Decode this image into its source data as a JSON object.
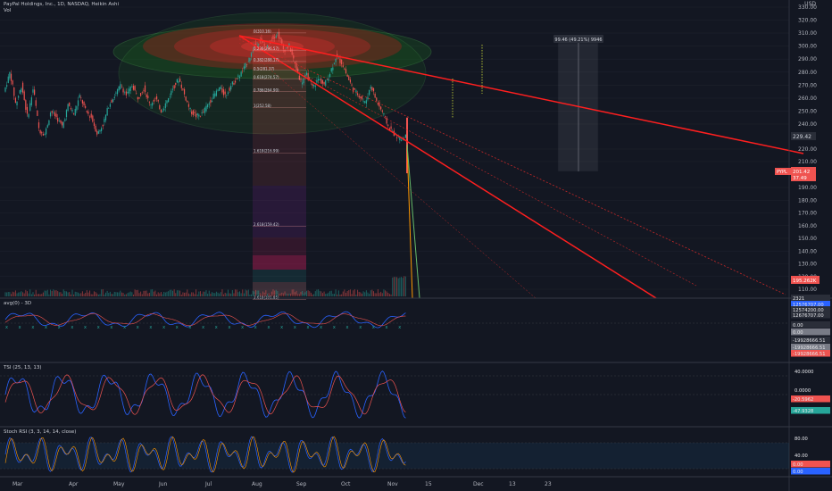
{
  "header": {
    "title": "PayPal Holdings, Inc., 1D, NASDAQ, Heikin Ashi",
    "vol_label": "Vol",
    "currency": "USD"
  },
  "panes": {
    "macd_title": "avg(0) - 3D",
    "tsi_title": "TSI (25, 13, 13)",
    "stoch_title": "Stoch RSI (3, 3, 14, 14, close)"
  },
  "colors": {
    "up": "#26a69a",
    "down": "#ef5350",
    "trendline": "#ff1f1f",
    "highlight_box": "#ef5350",
    "background": "#131722"
  },
  "price_labels": {
    "last": "229.42",
    "ticker": "PYPL",
    "ticker_price": "201.42",
    "ticker_sub": "37.49",
    "volume": "195.262K"
  },
  "measure_label": "99.46 (49.21%) 9946",
  "fib_levels": [
    {
      "label": "0(310.16)",
      "value": 310.16
    },
    {
      "label": "0.236(296.57)",
      "value": 296.57
    },
    {
      "label": "0.382(288.17)",
      "value": 288.17
    },
    {
      "label": "0.5(281.37)",
      "value": 281.37
    },
    {
      "label": "0.618(274.57)",
      "value": 274.57
    },
    {
      "label": "0.786(264.90)",
      "value": 264.9
    },
    {
      "label": "1(252.58)",
      "value": 252.58
    },
    {
      "label": "1.618(216.99)",
      "value": 216.99
    },
    {
      "label": "2.618(159.42)",
      "value": 159.42
    },
    {
      "label": "3.618(101.85)",
      "value": 101.85
    }
  ],
  "side_labels": {
    "macd": [
      "2321",
      "12576707.00",
      "12574200.00",
      "12676707.00",
      "0.00",
      "0.00"
    ],
    "macd_neg": [
      "-19928666.51",
      "-19928666.51",
      "-19928666.51"
    ],
    "tsi": [
      "40.0000",
      "0.0000",
      "-20.5962",
      "-47.9328"
    ],
    "stoch": [
      "80.00",
      "40.00",
      "0.00",
      "0.00"
    ]
  },
  "chart_data": {
    "type": "candlestick",
    "x_axis": {
      "labels": [
        "Mar",
        "Apr",
        "May",
        "Jun",
        "Jul",
        "Aug",
        "Sep",
        "Oct",
        "Nov",
        "15",
        "Dec",
        "13",
        "23"
      ]
    },
    "price_axis": {
      "ticks": [
        330,
        320,
        310,
        300,
        290,
        280,
        270,
        260,
        250,
        240,
        220,
        210,
        190,
        180,
        170,
        160,
        150,
        140,
        130,
        120,
        110
      ],
      "range": [
        105,
        335
      ]
    },
    "price_path": [
      [
        0,
        265
      ],
      [
        4,
        280
      ],
      [
        8,
        255
      ],
      [
        12,
        270
      ],
      [
        16,
        245
      ],
      [
        20,
        268
      ],
      [
        24,
        235
      ],
      [
        28,
        232
      ],
      [
        32,
        250
      ],
      [
        36,
        245
      ],
      [
        40,
        238
      ],
      [
        44,
        255
      ],
      [
        48,
        248
      ],
      [
        52,
        262
      ],
      [
        56,
        250
      ],
      [
        60,
        245
      ],
      [
        64,
        232
      ],
      [
        68,
        240
      ],
      [
        72,
        255
      ],
      [
        76,
        262
      ],
      [
        80,
        270
      ],
      [
        84,
        262
      ],
      [
        88,
        270
      ],
      [
        92,
        260
      ],
      [
        96,
        268
      ],
      [
        100,
        255
      ],
      [
        104,
        260
      ],
      [
        108,
        250
      ],
      [
        112,
        258
      ],
      [
        116,
        268
      ],
      [
        120,
        275
      ],
      [
        124,
        262
      ],
      [
        128,
        250
      ],
      [
        132,
        246
      ],
      [
        136,
        248
      ],
      [
        140,
        255
      ],
      [
        144,
        262
      ],
      [
        148,
        268
      ],
      [
        152,
        262
      ],
      [
        156,
        270
      ],
      [
        160,
        275
      ],
      [
        164,
        281
      ],
      [
        168,
        290
      ],
      [
        172,
        300
      ],
      [
        176,
        305
      ],
      [
        180,
        298
      ],
      [
        184,
        306
      ],
      [
        188,
        310
      ],
      [
        192,
        297
      ],
      [
        196,
        300
      ],
      [
        200,
        285
      ],
      [
        204,
        272
      ],
      [
        208,
        278
      ],
      [
        212,
        268
      ],
      [
        216,
        275
      ],
      [
        220,
        270
      ],
      [
        224,
        280
      ],
      [
        228,
        292
      ],
      [
        232,
        287
      ],
      [
        236,
        276
      ],
      [
        240,
        266
      ],
      [
        244,
        262
      ],
      [
        248,
        256
      ],
      [
        252,
        270
      ],
      [
        256,
        257
      ],
      [
        260,
        249
      ],
      [
        264,
        238
      ],
      [
        268,
        232
      ],
      [
        272,
        228
      ],
      [
        276,
        230
      ]
    ],
    "measure_range": [
      201.42,
      300.88
    ]
  }
}
